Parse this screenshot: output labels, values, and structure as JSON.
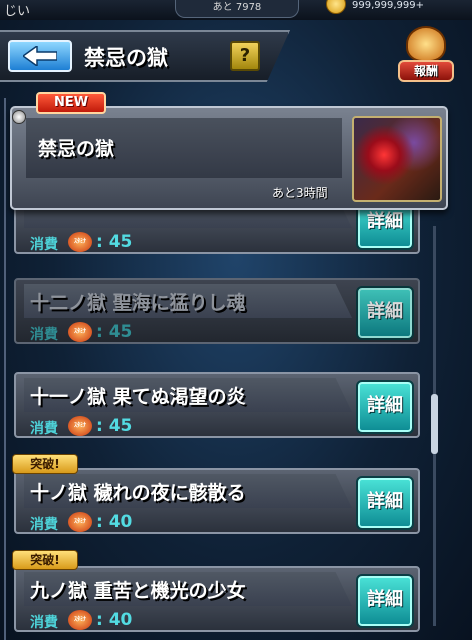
{
  "status_bar": {
    "left_text": "じい",
    "stamina_remaining": "あと 7978",
    "coins": "999,999,999+"
  },
  "header": {
    "title": "禁忌の獄",
    "help_label": "?",
    "reward_label": "報酬"
  },
  "event_card": {
    "badge": "NEW",
    "title": "禁忌の獄",
    "time_left": "あと3時間"
  },
  "quests": [
    {
      "name": "",
      "cost_label": "消費",
      "stamina_label": "ｽﾀﾐﾅ",
      "cost": ": 45",
      "detail": "詳細"
    },
    {
      "name": "十二ノ獄 聖海に猛りし魂",
      "cost_label": "消費",
      "stamina_label": "ｽﾀﾐﾅ",
      "cost": ": 45",
      "detail": "詳細"
    },
    {
      "name": "十一ノ獄 果てぬ渇望の炎",
      "cost_label": "消費",
      "stamina_label": "ｽﾀﾐﾅ",
      "cost": ": 45",
      "detail": "詳細"
    },
    {
      "badge": "突破!",
      "name": "十ノ獄 穢れの夜に骸散る",
      "cost_label": "消費",
      "stamina_label": "ｽﾀﾐﾅ",
      "cost": ": 40",
      "detail": "詳細"
    },
    {
      "badge": "突破!",
      "name": "九ノ獄 重苦と機光の少女",
      "cost_label": "消費",
      "stamina_label": "ｽﾀﾐﾅ",
      "cost": ": 40",
      "detail": "詳細"
    }
  ],
  "colors": {
    "accent_cyan": "#4be4d8",
    "back_button": "#1e7fd4",
    "new_badge": "#e0301a",
    "break_badge": "#f2c24a"
  }
}
